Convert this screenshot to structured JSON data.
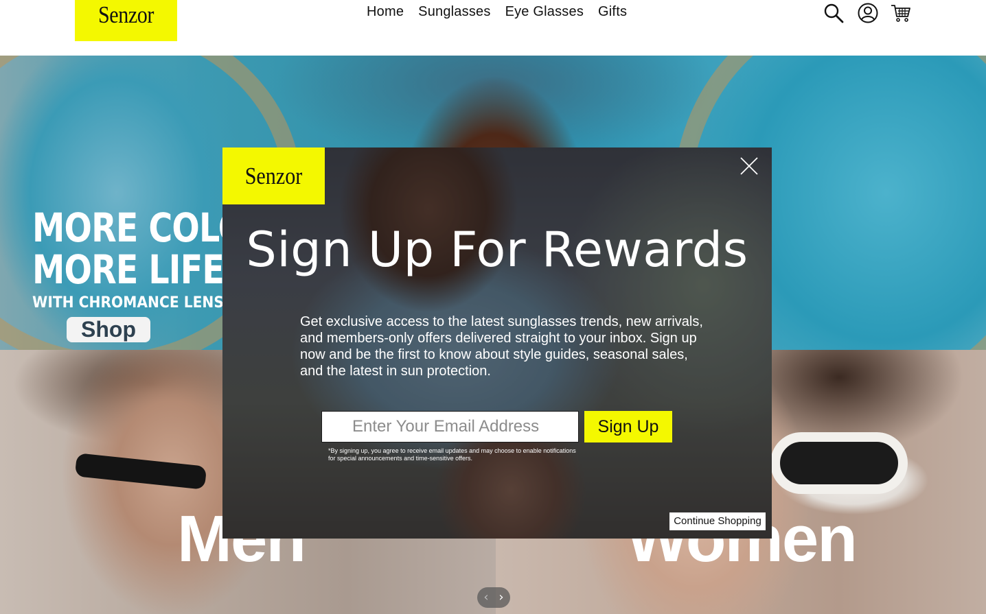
{
  "header": {
    "logo": "Senzor",
    "nav": [
      {
        "label": "Home"
      },
      {
        "label": "Sunglasses"
      },
      {
        "label": "Eye Glasses"
      },
      {
        "label": "Gifts"
      }
    ],
    "icons": [
      "search-icon",
      "account-icon",
      "cart-icon"
    ]
  },
  "hero": {
    "line1": "MORE COLOR",
    "line2": "MORE LIFE",
    "line3": "WITH CHROMANCE LENSES",
    "shop_label": "Shop"
  },
  "categories": {
    "men": "Men",
    "women": "Women"
  },
  "carousel": {
    "prev": "‹",
    "next": "›"
  },
  "modal": {
    "logo": "Senzor",
    "title": "Sign Up For Rewards",
    "description": "Get exclusive access to the latest sunglasses trends, new arrivals, and members-only offers delivered straight to your inbox. Sign up now and be the first to know about style guides, seasonal sales, and the latest in sun protection.",
    "email_placeholder": "Enter Your Email Address",
    "email_value": "",
    "signup_label": "Sign Up",
    "disclaimer": "*By signing up, you agree to receive email updates and may choose to enable notifications for special announcements and time-sensitive offers.",
    "continue_label": "Continue Shopping"
  },
  "colors": {
    "brand_yellow": "#f4f800",
    "white": "#ffffff",
    "text_dark": "#111111"
  }
}
